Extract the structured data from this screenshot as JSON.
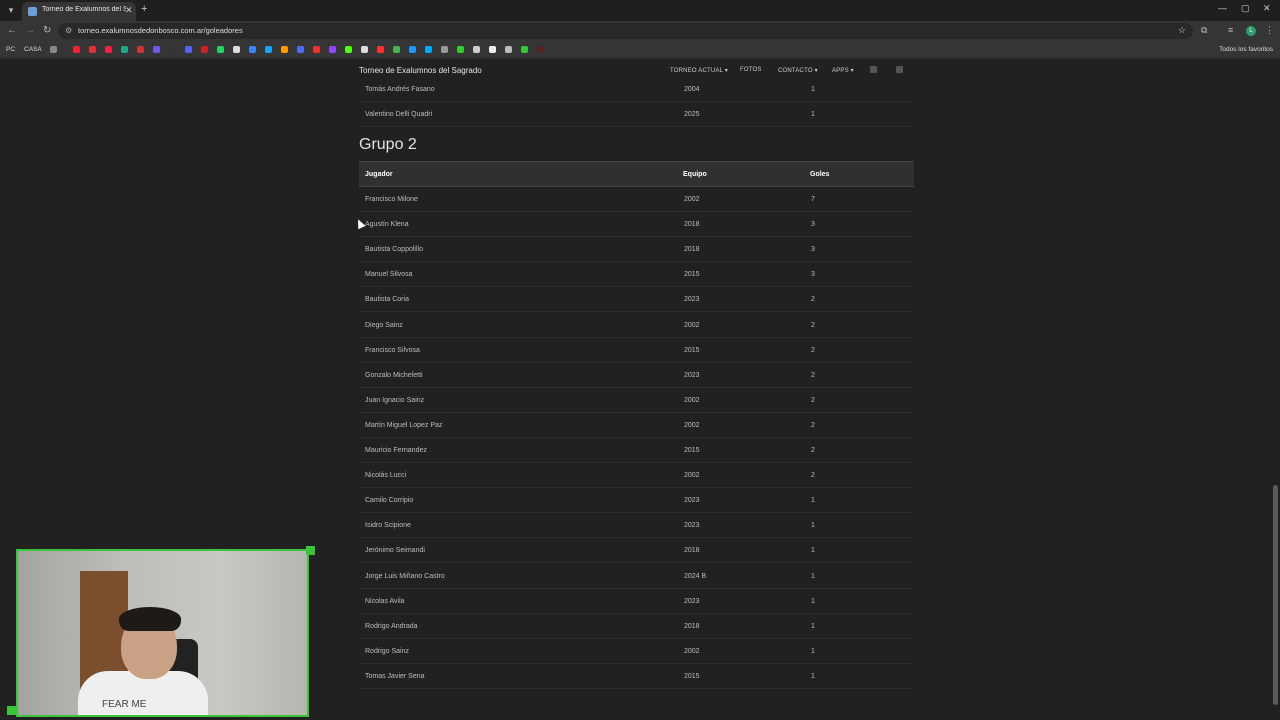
{
  "browser": {
    "tab_title": "Torneo de Exalumnos del Sagrad",
    "tab_close": "✕",
    "new_tab": "+",
    "url": "torneo.exalumnosdedonbosco.com.ar/goleadores",
    "bookmarks": [
      {
        "label": "PC"
      },
      {
        "label": "CASA"
      }
    ],
    "bookmarks_right": "Todos los favoritos",
    "avatar_letter": "L"
  },
  "site": {
    "brand": "Torneo de Exalumnos del Sagrado",
    "nav": [
      {
        "label": "TORNEO ACTUAL ▾"
      },
      {
        "label": "FOTOS"
      },
      {
        "label": "CONTACTO ▾"
      },
      {
        "label": "APPS ▾"
      }
    ]
  },
  "group1_tail": [
    {
      "jugador": "Tomás Andrés Fasano",
      "equipo": "2004",
      "goles": "1"
    },
    {
      "jugador": "Valentino Delli Quadri",
      "equipo": "2025",
      "goles": "1"
    }
  ],
  "group2": {
    "title": "Grupo 2",
    "headers": {
      "jugador": "Jugador",
      "equipo": "Equipo",
      "goles": "Goles"
    },
    "rows": [
      {
        "jugador": "Francisco Milone",
        "equipo": "2002",
        "goles": "7"
      },
      {
        "jugador": "Agustín Klena",
        "equipo": "2018",
        "goles": "3"
      },
      {
        "jugador": "Bautista Coppolillo",
        "equipo": "2018",
        "goles": "3"
      },
      {
        "jugador": "Manuel Silvosa",
        "equipo": "2015",
        "goles": "3"
      },
      {
        "jugador": "Bautista Coria",
        "equipo": "2023",
        "goles": "2"
      },
      {
        "jugador": "Diego Sainz",
        "equipo": "2002",
        "goles": "2"
      },
      {
        "jugador": "Francisco Silvosa",
        "equipo": "2015",
        "goles": "2"
      },
      {
        "jugador": "Gonzalo Micheletti",
        "equipo": "2023",
        "goles": "2"
      },
      {
        "jugador": "Juan Ignacio Sainz",
        "equipo": "2002",
        "goles": "2"
      },
      {
        "jugador": "Martín Miguel Lopez Paz",
        "equipo": "2002",
        "goles": "2"
      },
      {
        "jugador": "Mauricio Fernandez",
        "equipo": "2015",
        "goles": "2"
      },
      {
        "jugador": "Nicolás Lucci",
        "equipo": "2002",
        "goles": "2"
      },
      {
        "jugador": "Camilo Corripio",
        "equipo": "2023",
        "goles": "1"
      },
      {
        "jugador": "Isidro Scipione",
        "equipo": "2023",
        "goles": "1"
      },
      {
        "jugador": "Jerónimo Seimandi",
        "equipo": "2018",
        "goles": "1"
      },
      {
        "jugador": "Jorge Luis Miñano Castro",
        "equipo": "2024 B",
        "goles": "1"
      },
      {
        "jugador": "Nicolas Avila",
        "equipo": "2023",
        "goles": "1"
      },
      {
        "jugador": "Rodrigo Andrada",
        "equipo": "2018",
        "goles": "1"
      },
      {
        "jugador": "Rodrigo Sainz",
        "equipo": "2002",
        "goles": "1"
      },
      {
        "jugador": "Tomas Javier Sena",
        "equipo": "2015",
        "goles": "1"
      }
    ]
  },
  "webcam": {
    "shirt_text": "FEAR ME"
  }
}
